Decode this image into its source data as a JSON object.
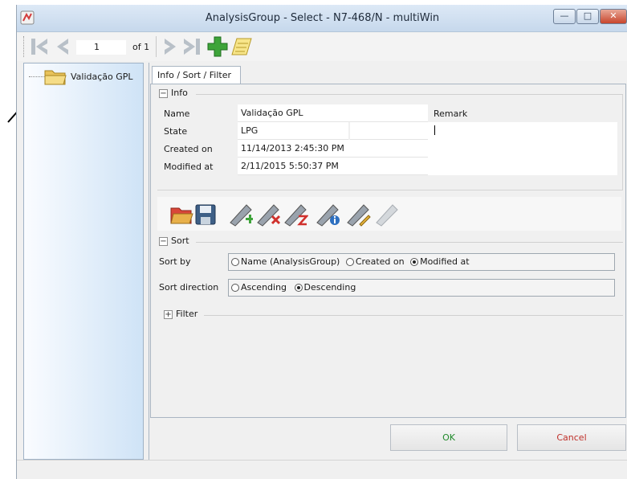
{
  "window": {
    "title": "AnalysisGroup - Select - N7-468/N - multiWin"
  },
  "nav": {
    "page": "1",
    "of_label": "of 1"
  },
  "tree": {
    "item": "Validação GPL"
  },
  "tab": {
    "label": "Info / Sort / Filter"
  },
  "info": {
    "toggle": "−",
    "header": "Info",
    "name_label": "Name",
    "name_value": "Validação GPL",
    "state_label": "State",
    "state_value": "LPG",
    "created_label": "Created on",
    "created_value": "11/14/2013 2:45:30 PM",
    "modified_label": "Modified at",
    "modified_value": "2/11/2015 5:50:37 PM",
    "remark_label": "Remark"
  },
  "sort": {
    "toggle": "−",
    "header": "Sort",
    "sortby_label": "Sort by",
    "options": [
      "Name (AnalysisGroup)",
      "Created on",
      "Modified at"
    ],
    "selected_option": "Modified at",
    "direction_label": "Sort direction",
    "directions": [
      "Ascending",
      "Descending"
    ],
    "selected_direction": "Descending"
  },
  "filter": {
    "toggle": "+",
    "header": "Filter"
  },
  "buttons": {
    "ok": "OK",
    "cancel": "Cancel"
  }
}
